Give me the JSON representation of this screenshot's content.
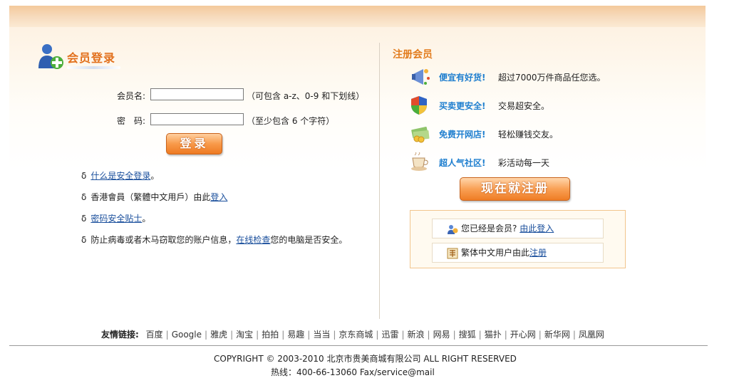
{
  "login": {
    "title": "会员登录",
    "username_label": "会员名:",
    "username_value": "",
    "username_hint": "（可包含 a-z、0-9 和下划线）",
    "password_label": "密　码:",
    "password_value": "",
    "password_hint": "（至少包含 6 个字符）",
    "submit_label": "登录"
  },
  "tips": {
    "bullet": "δ",
    "items": [
      {
        "link": "什么是安全登录",
        "suffix": "。"
      },
      {
        "prefix": "香港會員（繁體中文用戶）由此",
        "link": "登入"
      },
      {
        "link": "密码安全贴士",
        "suffix": "。"
      },
      {
        "prefix": "防止病毒或者木马窃取您的账户信息，",
        "link": "在线检查",
        "suffix": "您的电脑是否安全。"
      }
    ]
  },
  "register": {
    "title": "注册会员",
    "features": [
      {
        "icon": "megaphone-icon",
        "title": "便宜有好货!",
        "desc": "超过7000万件商品任您选。"
      },
      {
        "icon": "shield-icon",
        "title": "买卖更安全!",
        "desc": "交易超安全。"
      },
      {
        "icon": "money-icon",
        "title": "免费开网店!",
        "desc": "轻松赚钱交友。"
      },
      {
        "icon": "coffee-icon",
        "title": "超人气社区!",
        "desc": "彩活动每一天"
      }
    ],
    "button_label": "现在就注册",
    "already_member_text": "您已经是会员?",
    "already_member_link": "由此登入",
    "traditional_text": "繁体中文用户由此",
    "traditional_link": "注册"
  },
  "footer": {
    "friend_links_label": "友情链接:",
    "friend_links": [
      "百度",
      "Google",
      "雅虎",
      "淘宝",
      "拍拍",
      "易趣",
      "当当",
      "京东商城",
      "迅雷",
      "新浪",
      "网易",
      "搜狐",
      "猫扑",
      "开心网",
      "新华网",
      "凤凰网"
    ],
    "copyright": "COPYRIGHT © 2003-2010 北京市贵美商城有限公司 ALL RIGHT RESERVED",
    "hotline": "热线：400-66-13060 Fax/service@mail"
  },
  "colors": {
    "accent_orange": "#e2701c",
    "feature_blue": "#1f7fcf",
    "link_blue": "#1a4f9c"
  }
}
